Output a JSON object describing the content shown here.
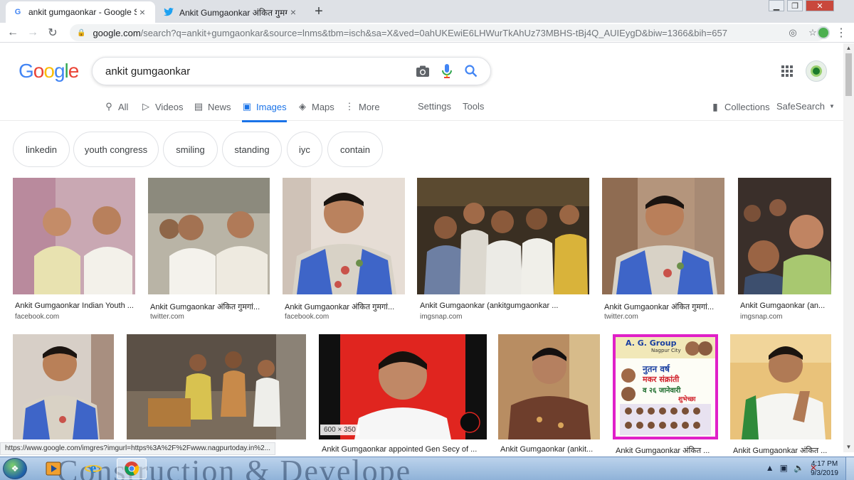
{
  "browser": {
    "tabs": [
      {
        "title": "ankit gumgaonkar - Google Sear",
        "close": "×",
        "favicon": "google-icon"
      },
      {
        "title": "Ankit Gumgaonkar अंकित गुमगांव",
        "close": "×",
        "favicon": "twitter-icon"
      }
    ],
    "new_tab": "+",
    "url_host": "google.com",
    "url_rest": "/search?q=ankit+gumgaonkar&source=lnms&tbm=isch&sa=X&ved=0ahUKEwiE6LHWurTkAhUz73MBHS-tBj4Q_AUIEygD&biw=1366&bih=657",
    "status_url": "https://www.google.com/imgres?imgurl=https%3A%2F%2Fwww.nagpurtoday.in%2..."
  },
  "google": {
    "logo": [
      "G",
      "o",
      "o",
      "g",
      "l",
      "e"
    ],
    "query": "ankit gumgaonkar",
    "search_tabs": [
      {
        "label": "All",
        "icon": "search-icon"
      },
      {
        "label": "Videos",
        "icon": "play-icon"
      },
      {
        "label": "News",
        "icon": "news-icon"
      },
      {
        "label": "Images",
        "icon": "image-icon"
      },
      {
        "label": "Maps",
        "icon": "map-icon"
      },
      {
        "label": "More",
        "icon": "more-icon"
      }
    ],
    "settings": "Settings",
    "tools": "Tools",
    "collections": "Collections",
    "safesearch": "SafeSearch",
    "chips": [
      "linkedin",
      "youth congress",
      "smiling",
      "standing",
      "iyc",
      "contain"
    ]
  },
  "results": [
    {
      "caption": "Ankit Gumgaonkar Indian Youth ...",
      "source": "facebook.com"
    },
    {
      "caption": "Ankit Gumgaonkar अंकित गुमगां...",
      "source": "twitter.com"
    },
    {
      "caption": "Ankit Gumgaonkar अंकित गुमगां...",
      "source": "facebook.com"
    },
    {
      "caption": "Ankit Gumgaonkar (ankitgumgaonkar ...",
      "source": "imgsnap.com"
    },
    {
      "caption": "Ankit Gumgaonkar अंकित गुमगां...",
      "source": "twitter.com"
    },
    {
      "caption": "Ankit Gumgaonkar (an...",
      "source": "imgsnap.com"
    },
    {
      "caption": "",
      "source": ""
    },
    {
      "caption": "",
      "source": ""
    },
    {
      "caption": "Ankit Gumgaonkar appointed Gen Secy of ...",
      "source": "",
      "dims": "600 × 350"
    },
    {
      "caption": "Ankit Gumgaonkar (ankit...",
      "source": ""
    },
    {
      "caption": "Ankit Gumgaonkar अंकित ...",
      "source": ""
    },
    {
      "caption": "Ankit Gumgaonkar अंकित ...",
      "source": ""
    }
  ],
  "poster": {
    "brand": "A. G. Group",
    "city": "Nagpur City",
    "line1": "नुतन वर्ष",
    "line2": "मकर संक्रांती",
    "line3": "व २६ जानेवारी",
    "wish": "शुभेच्छा"
  },
  "taskbar": {
    "wallpaper_text": "Construction & Develope",
    "time": "4:17 PM",
    "date": "9/3/2019"
  },
  "colors": {
    "accent": "#1a73e8",
    "tabstrip": "#dee1e6"
  }
}
